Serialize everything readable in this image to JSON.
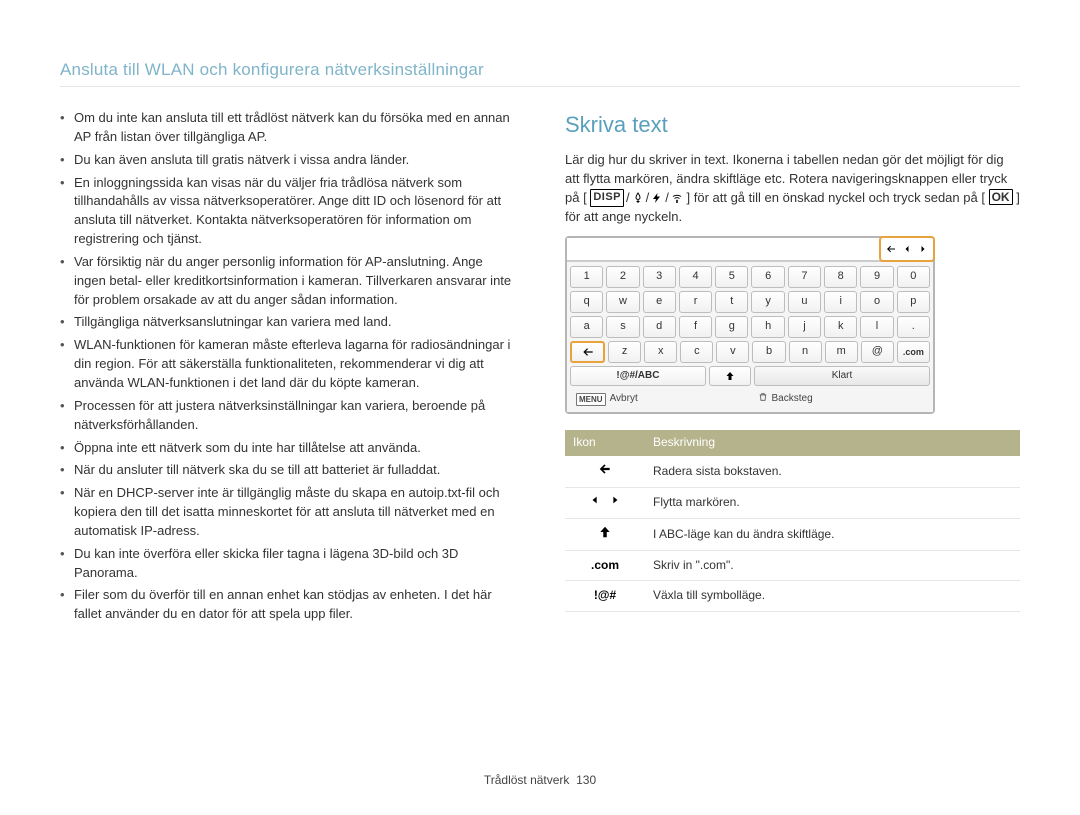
{
  "header": "Ansluta till WLAN och konfigurera nätverksinställningar",
  "left_bullets": [
    "Om du inte kan ansluta till ett trådlöst nätverk kan du försöka med en annan AP från listan över tillgängliga AP.",
    "Du kan även ansluta till gratis nätverk i vissa andra länder.",
    "En inloggningssida kan visas när du väljer fria trådlösa nätverk som tillhandahålls av vissa nätverksoperatörer. Ange ditt ID och lösenord för att ansluta till nätverket. Kontakta nätverksoperatören för information om registrering och tjänst.",
    "Var försiktig när du anger personlig information för AP-anslutning. Ange ingen betal- eller kreditkortsinformation i kameran. Tillverkaren ansvarar inte för problem orsakade av att du anger sådan information.",
    "Tillgängliga nätverksanslutningar kan variera med land.",
    "WLAN-funktionen för kameran måste efterleva lagarna för radiosändningar i din region. För att säkerställa funktionaliteten, rekommenderar vi dig att använda WLAN-funktionen i det land där du köpte kameran.",
    "Processen för att justera nätverksinställningar kan variera, beroende på nätverksförhållanden.",
    "Öppna inte ett nätverk som du inte har tillåtelse att använda.",
    "När du ansluter till nätverk ska du se till att batteriet är fulladdat.",
    "När en DHCP-server inte är tillgänglig måste du skapa en autoip.txt-fil och kopiera den till det isatta minneskortet för att ansluta till nätverket med en automatisk IP-adress.",
    "Du kan inte överföra eller skicka filer tagna i lägena 3D-bild och 3D Panorama.",
    "Filer som du överför till en annan enhet kan stödjas av enheten. I det här fallet använder du en dator för att spela upp filer."
  ],
  "right": {
    "heading": "Skriva text",
    "intro_a": "Lär dig hur du skriver in text. Ikonerna i tabellen nedan gör det möjligt för dig att flytta markören, ändra skiftläge etc. Rotera navigeringsknappen eller tryck på [",
    "intro_b": "] för att gå till en önskad nyckel och tryck sedan på [",
    "intro_c": "] för att ange nyckeln."
  },
  "keyboard": {
    "rows": [
      [
        "1",
        "2",
        "3",
        "4",
        "5",
        "6",
        "7",
        "8",
        "9",
        "0"
      ],
      [
        "q",
        "w",
        "e",
        "r",
        "t",
        "y",
        "u",
        "i",
        "o",
        "p"
      ],
      [
        "a",
        "s",
        "d",
        "f",
        "g",
        "h",
        "j",
        "k",
        "l",
        "."
      ],
      [
        "←",
        "z",
        "x",
        "c",
        "v",
        "b",
        "n",
        "m",
        "@",
        ".com"
      ]
    ],
    "mode_label": "!@#/ABC",
    "done_label": "Klart",
    "cancel_label": "Avbryt",
    "back_label": "Backsteg",
    "menu_chip": "MENU"
  },
  "icon_table": {
    "headers": {
      "icon": "Ikon",
      "desc": "Beskrivning"
    },
    "rows": [
      {
        "icon": "arrow-left-thick",
        "desc": "Radera sista bokstaven."
      },
      {
        "icon": "two-tri",
        "desc": "Flytta markören."
      },
      {
        "icon": "arrow-up-thick",
        "desc": "I ABC-läge kan du ändra skiftläge."
      },
      {
        "icon": "dotcom",
        "label": ".com",
        "desc": "Skriv in \".com\"."
      },
      {
        "icon": "symbols",
        "label": "!@#",
        "desc": "Växla till symbolläge."
      }
    ]
  },
  "footer": {
    "section": "Trådlöst nätverk",
    "page": "130"
  }
}
